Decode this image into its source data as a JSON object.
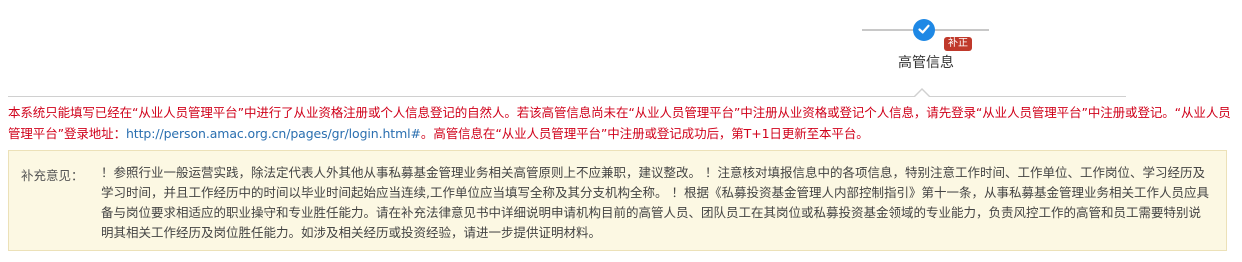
{
  "step": {
    "label": "高管信息",
    "badge": "补正",
    "icon": "check-icon",
    "accent_color": "#1e88e5",
    "badge_color": "#c0392b"
  },
  "notice": {
    "text_before_link": "本系统只能填写已经在“从业人员管理平台”中进行了从业资格注册或个人信息登记的自然人。若该高管信息尚未在“从业人员管理平台”中注册从业资格或登记个人信息，请先登录“从业人员管理平台”中注册或登记。“从业人员管理平台”登录地址：",
    "link_text": "http://person.amac.org.cn/pages/gr/login.html#",
    "text_after_link": "。高管信息在“从业人员管理平台”中注册或登记成功后，第T+1日更新至本平台。",
    "color": "#d0021b"
  },
  "supplement": {
    "label": "补充意见：",
    "text": "！参照行业一般运营实践，除法定代表人外其他从事私募基金管理业务相关高管原则上不应兼职，建议整改。 ！注意核对填报信息中的各项信息，特别注意工作时间、工作单位、工作岗位、学习经历及学习时间，并且工作经历中的时间以毕业时间起始应当连续,工作单位应当填写全称及其分支机构全称。 ！根据《私募投资基金管理人内部控制指引》第十一条，从事私募基金管理业务相关工作人员应具备与岗位要求相适应的职业操守和专业胜任能力。请在补充法律意见书中详细说明申请机构目前的高管人员、团队员工在其岗位或私募投资基金领域的专业能力，负责风控工作的高管和员工需要特别说明其相关工作经历及岗位胜任能力。如涉及相关经历或投资经验，请进一步提供证明材料。",
    "background": "#fcf8e3"
  }
}
